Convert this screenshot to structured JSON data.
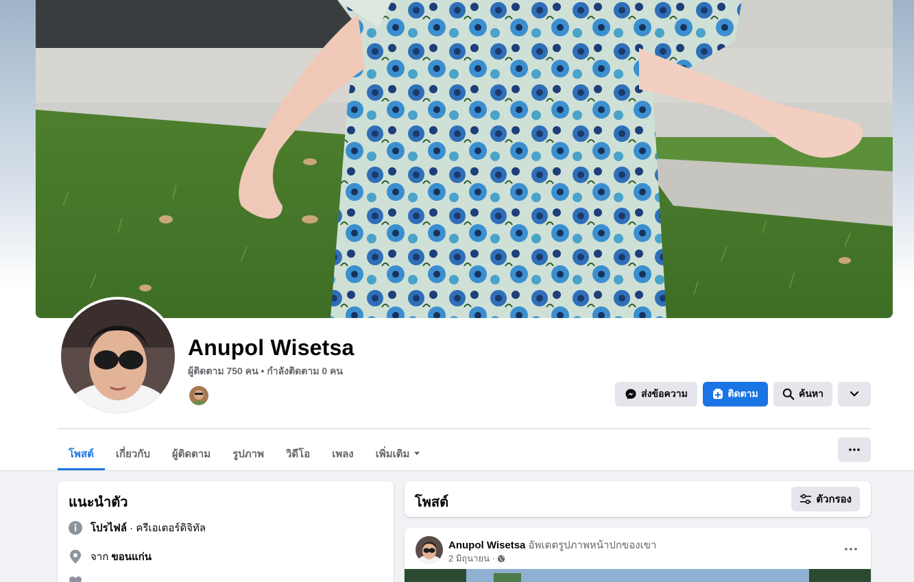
{
  "profile": {
    "name": "Anupol Wisetsa",
    "stats": "ผู้ติดตาม 750 คน • กำลังติดตาม 0 คน"
  },
  "actions": {
    "message_label": "ส่งข้อความ",
    "follow_label": "ติดตาม",
    "search_label": "ค้นหา"
  },
  "tabs": [
    {
      "label": "โพสต์"
    },
    {
      "label": "เกี่ยวกับ"
    },
    {
      "label": "ผู้ติดตาม"
    },
    {
      "label": "รูปภาพ"
    },
    {
      "label": "วิดีโอ"
    },
    {
      "label": "เพลง"
    },
    {
      "label": "เพิ่มเติม"
    }
  ],
  "intro": {
    "title": "แนะนำตัว",
    "profile_prefix": "โปรไฟล์",
    "profile_category": " · ครีเอเตอร์ดิจิทัล",
    "from_prefix": "จาก ",
    "from_place": "ขอนแก่น"
  },
  "posts": {
    "title": "โพสต์",
    "filter_label": "ตัวกรอง",
    "items": [
      {
        "author": "Anupol Wisetsa",
        "action": " อัพเดตรูปภาพหน้าปกของเขา",
        "date": "2 มิถุนายน ·"
      }
    ]
  },
  "colors": {
    "accent": "#1b74e4",
    "button_gray": "#e4e6eb",
    "page_bg": "#f0f2f5",
    "muted_text": "#65676b"
  }
}
